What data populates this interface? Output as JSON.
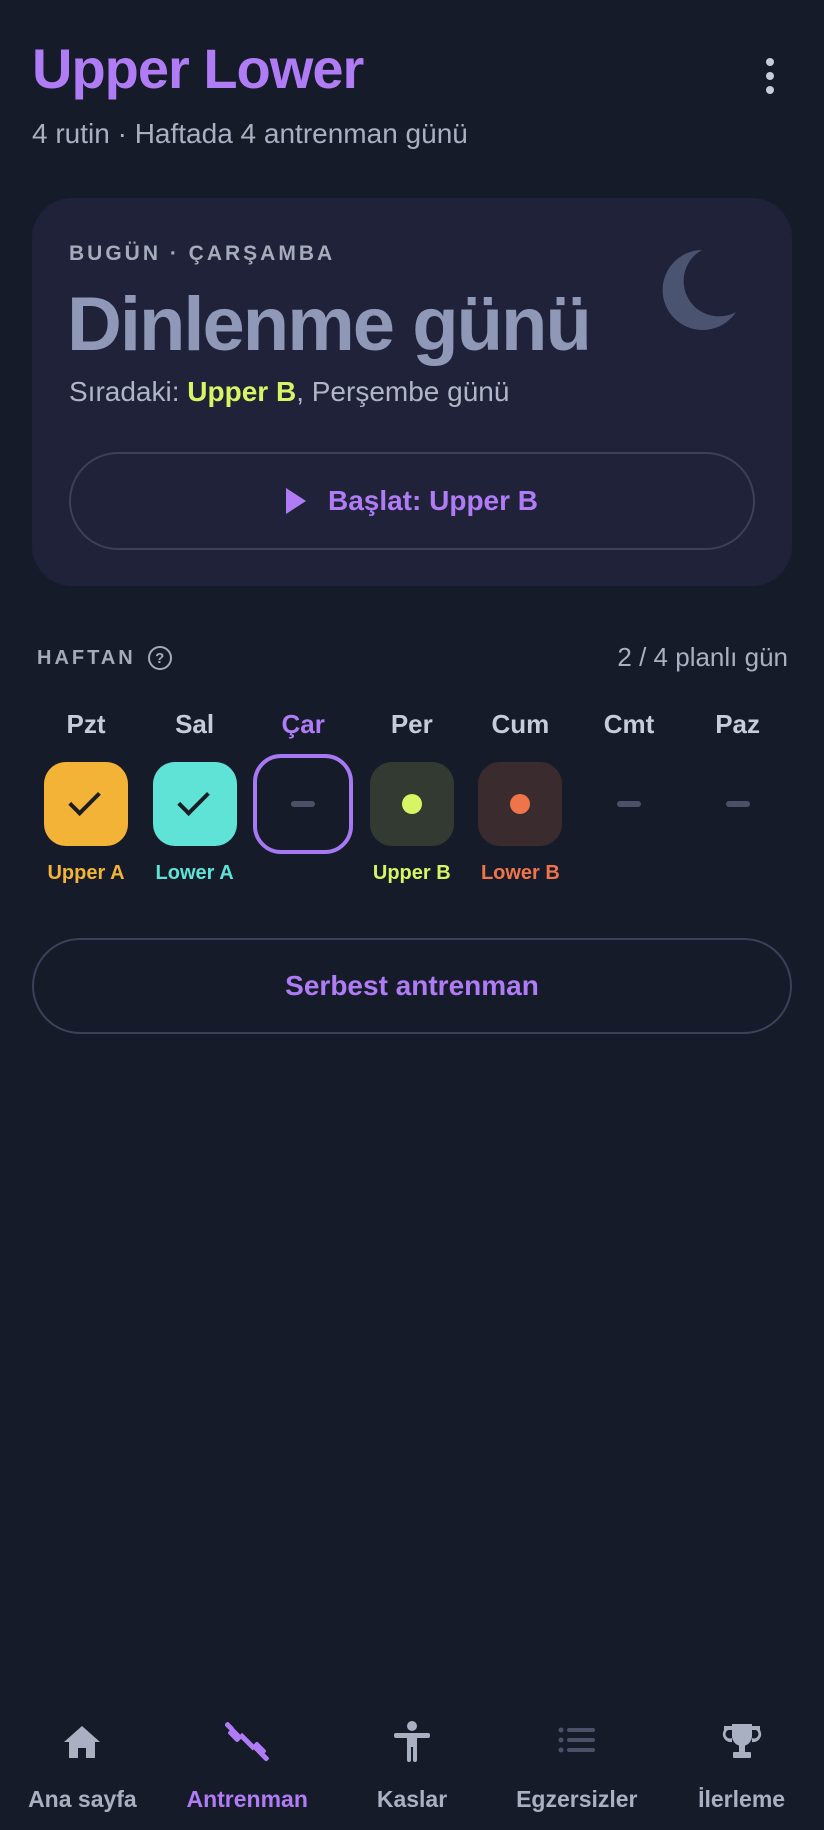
{
  "header": {
    "title": "Upper Lower",
    "subtitle": "4 rutin · Haftada 4 antrenman günü"
  },
  "today": {
    "eyebrow": "BUGÜN · ÇARŞAMBA",
    "title": "Dinlenme günü",
    "next_prefix": "Sıradaki: ",
    "next_routine": "Upper B",
    "next_suffix": ", Perşembe günü",
    "start_label": "Başlat: Upper B",
    "icon": "moon-icon"
  },
  "week": {
    "label": "HAFTAN",
    "count": "2 / 4 planlı gün",
    "days": [
      {
        "name": "Pzt",
        "status": "done",
        "routine": "Upper A",
        "color": "#f2b336"
      },
      {
        "name": "Sal",
        "status": "done",
        "routine": "Lower A",
        "color": "#5ee3d6"
      },
      {
        "name": "Çar",
        "status": "today-rest",
        "routine": "",
        "color": "#b07cf5"
      },
      {
        "name": "Per",
        "status": "planned",
        "routine": "Upper B",
        "color": "#d7f465"
      },
      {
        "name": "Cum",
        "status": "planned",
        "routine": "Lower B",
        "color": "#f0744a"
      },
      {
        "name": "Cmt",
        "status": "rest",
        "routine": "",
        "color": "#4b5268"
      },
      {
        "name": "Paz",
        "status": "rest",
        "routine": "",
        "color": "#4b5268"
      }
    ]
  },
  "free_workout_label": "Serbest antrenman",
  "nav": {
    "items": [
      {
        "label": "Ana sayfa",
        "icon": "home-icon",
        "active": false
      },
      {
        "label": "Antrenman",
        "icon": "dumbbell-icon",
        "active": true
      },
      {
        "label": "Kaslar",
        "icon": "body-icon",
        "active": false
      },
      {
        "label": "Egzersizler",
        "icon": "list-icon",
        "active": false
      },
      {
        "label": "İlerleme",
        "icon": "trophy-icon",
        "active": false
      }
    ]
  }
}
